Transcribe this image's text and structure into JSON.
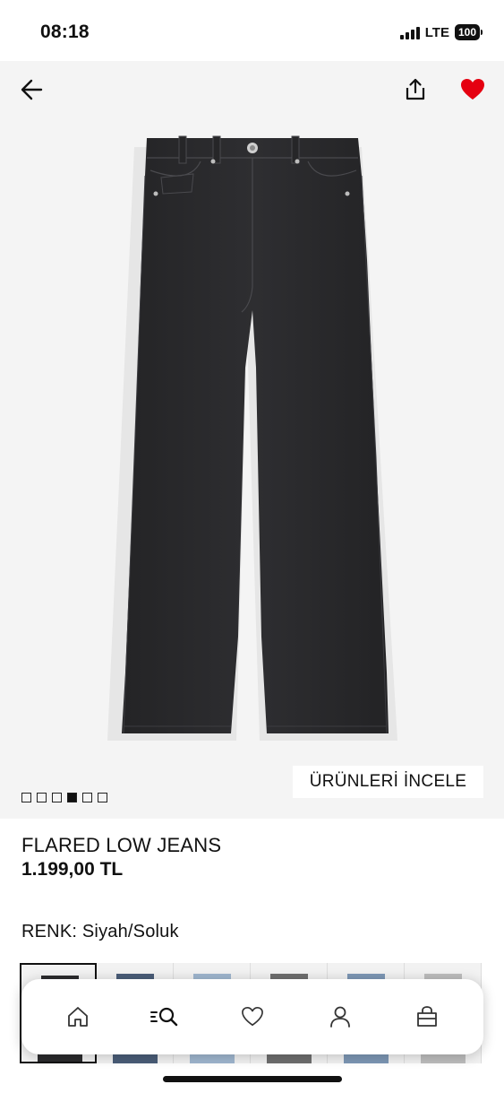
{
  "status_bar": {
    "time": "08:18",
    "network": "LTE",
    "battery": "100"
  },
  "gallery": {
    "image_count": 6,
    "active_index": 3,
    "inspect_button_label": "ÜRÜNLERİ İNCELE",
    "favorite_color": "#e50010",
    "denim_color": "#2a2a2c"
  },
  "product": {
    "name": "FLARED LOW JEANS",
    "price": "1.199,00 TL",
    "color_label": "RENK: Siyah/Soluk"
  },
  "swatches": [
    {
      "color": "#2b2b2d",
      "selected": true
    },
    {
      "color": "#4a5d78",
      "selected": false
    },
    {
      "color": "#9fb6cf",
      "selected": false
    },
    {
      "color": "#6e6e6e",
      "selected": false
    },
    {
      "color": "#7d97b5",
      "selected": false
    },
    {
      "color": "#bdbdbd",
      "selected": false
    }
  ],
  "nav": {
    "items": [
      "home-icon",
      "search-icon",
      "heart-icon",
      "account-icon",
      "bag-icon"
    ]
  }
}
